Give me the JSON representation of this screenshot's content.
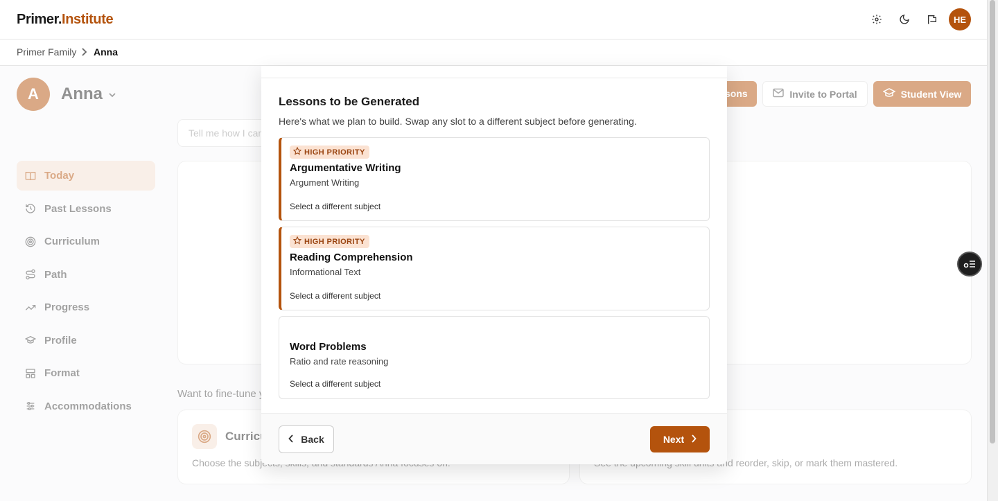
{
  "app": {
    "logo_part1": "Primer.",
    "logo_part2": "Institute",
    "user_initials": "HE"
  },
  "breadcrumb": {
    "parent": "Primer Family",
    "current": "Anna"
  },
  "student": {
    "initial": "A",
    "name": "Anna"
  },
  "header_buttons": {
    "lessons_fragment": "sons",
    "invite": "Invite to Portal",
    "student_view": "Student View"
  },
  "chat": {
    "placeholder": "Tell me how I can"
  },
  "sidebar": {
    "items": [
      {
        "label": "Today",
        "icon": "book-open-icon"
      },
      {
        "label": "Past Lessons",
        "icon": "history-icon"
      },
      {
        "label": "Curriculum",
        "icon": "target-icon"
      },
      {
        "label": "Path",
        "icon": "route-icon"
      },
      {
        "label": "Progress",
        "icon": "trending-up-icon"
      },
      {
        "label": "Profile",
        "icon": "graduation-cap-icon"
      },
      {
        "label": "Format",
        "icon": "layout-icon"
      },
      {
        "label": "Accommodations",
        "icon": "sliders-icon"
      }
    ]
  },
  "finetune": {
    "text": "Want to fine-tune y"
  },
  "tiles": {
    "curriculum": {
      "title": "Curricu",
      "desc": "Choose the subjects, skills, and standards Anna focuses on."
    },
    "path": {
      "desc": "See the upcoming skill units and reorder, skip, or mark them mastered."
    }
  },
  "modal": {
    "title": "Lessons to be Generated",
    "subtitle": "Here's what we plan to build. Swap any slot to a different subject before generating.",
    "slots": [
      {
        "priority": true,
        "badge": "HIGH PRIORITY",
        "title": "Argumentative Writing",
        "subtitle": "Argument Writing",
        "change": "Select a different subject"
      },
      {
        "priority": true,
        "badge": "HIGH PRIORITY",
        "title": "Reading Comprehension",
        "subtitle": "Informational Text",
        "change": "Select a different subject"
      },
      {
        "priority": false,
        "badge": "",
        "title": "Word Problems",
        "subtitle": "Ratio and rate reasoning",
        "change": "Select a different subject"
      }
    ],
    "back": "Back",
    "next": "Next"
  },
  "colors": {
    "accent": "#b4530d",
    "accent_soft": "#f3dfd0",
    "badge_bg": "#fbe2d2"
  }
}
